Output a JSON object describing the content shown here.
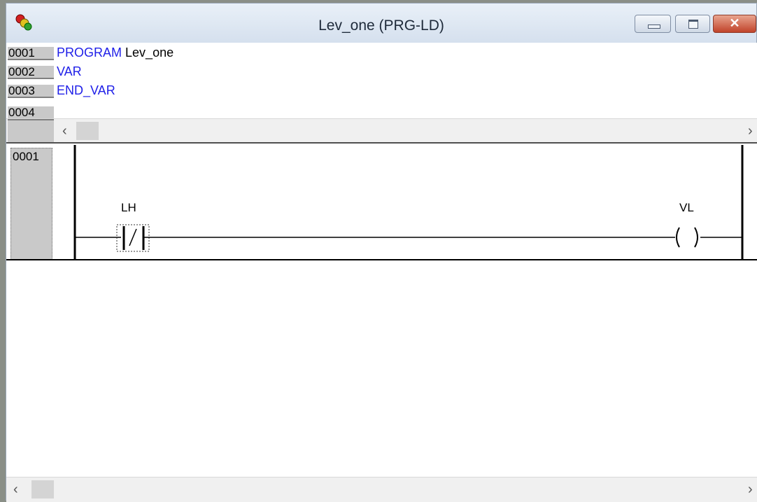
{
  "window": {
    "title": "Lev_one (PRG-LD)",
    "app_icon": "codesys-traffic-light-icon",
    "controls": {
      "minimize_icon": "minimize-icon",
      "maximize_icon": "maximize-icon",
      "close_icon": "close-icon",
      "close_glyph": "✕"
    }
  },
  "declaration": {
    "lines": [
      {
        "num": "0001",
        "keyword": "PROGRAM",
        "ident": "Lev_one"
      },
      {
        "num": "0002",
        "keyword": "VAR",
        "ident": ""
      },
      {
        "num": "0003",
        "keyword": "END_VAR",
        "ident": ""
      },
      {
        "num": "0004",
        "keyword": "",
        "ident": ""
      }
    ],
    "scroll_left": "‹",
    "scroll_right": "›"
  },
  "ladder": {
    "network_number": "0001",
    "contact": {
      "variable": "LH",
      "type": "negated-contact",
      "symbol": "|/|"
    },
    "coil": {
      "variable": "VL",
      "type": "coil",
      "symbol": "( )"
    },
    "scroll_left": "‹",
    "scroll_right": "›"
  },
  "colors": {
    "keyword": "#2020e8",
    "rail": "#000000",
    "close_button": "#c0432a"
  }
}
